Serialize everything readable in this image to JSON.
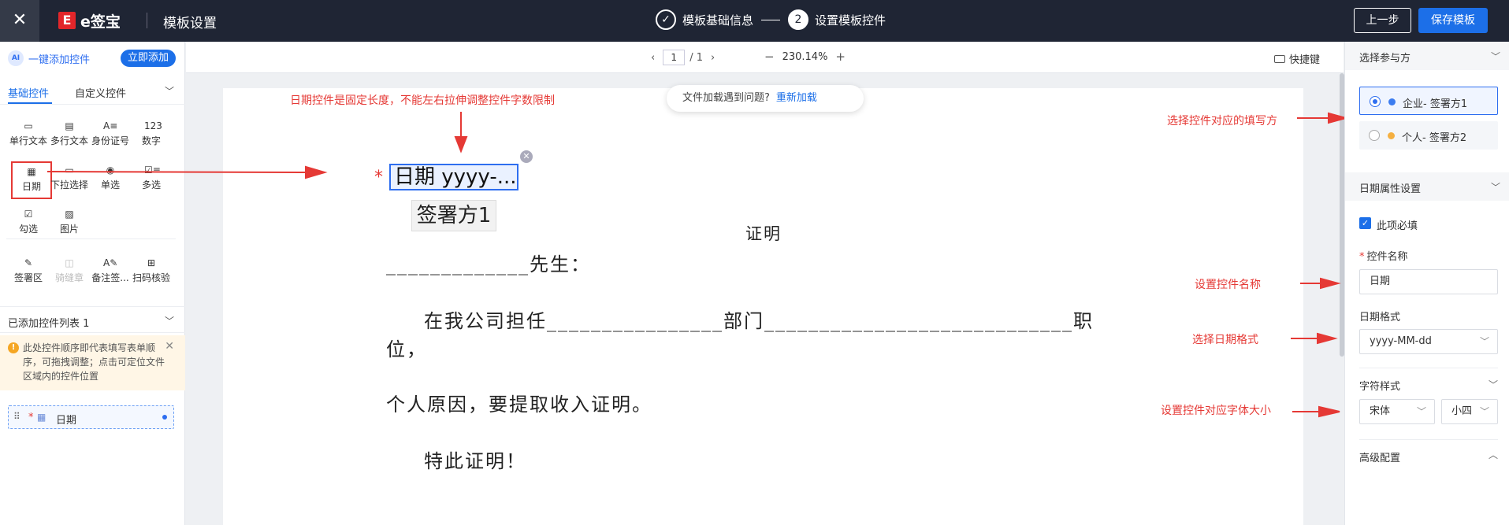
{
  "topbar": {
    "close_icon": "close-icon",
    "logo_mark": "E",
    "logo_text": "e签宝",
    "page_name": "模板设置",
    "steps": [
      {
        "num": "✓",
        "label": "模板基础信息"
      },
      {
        "num": "2",
        "label": "设置模板控件"
      }
    ],
    "prev_label": "上一步",
    "save_label": "保存模板"
  },
  "left": {
    "ai_icon_text": "AI",
    "ai_label": "一键添加控件",
    "ai_button": "立即添加",
    "tabs": [
      "基础控件",
      "自定义控件"
    ],
    "controls": [
      {
        "label": "单行文本",
        "icon": "▭"
      },
      {
        "label": "多行文本",
        "icon": "▤"
      },
      {
        "label": "身份证号",
        "icon": "A≡"
      },
      {
        "label": "数字",
        "icon": "123"
      },
      {
        "label": "日期",
        "icon": "▦"
      },
      {
        "label": "下拉选择",
        "icon": "▭"
      },
      {
        "label": "单选",
        "icon": "◉"
      },
      {
        "label": "多选",
        "icon": "☑≡"
      },
      {
        "label": "勾选",
        "icon": "☑"
      },
      {
        "label": "图片",
        "icon": "▨"
      },
      {
        "label": "签署区",
        "icon": "✎"
      },
      {
        "label": "骑缝章",
        "icon": "◫"
      },
      {
        "label": "备注签...",
        "icon": "A✎"
      },
      {
        "label": "扫码核验",
        "icon": "⊞"
      }
    ],
    "added_title": "已添加控件列表 1",
    "tip_icon_text": "!",
    "tip_text": "此处控件顺序即代表填写表单顺序，可拖拽调整；点击可定位文件区域内的控件位置",
    "added_items": [
      {
        "label": "日期"
      }
    ]
  },
  "toolbar": {
    "page_current": "1",
    "page_total": "/ 1",
    "zoom": "230.14%",
    "hotkey": "快捷键"
  },
  "notice": {
    "text": "文件加载遇到问题?",
    "link": "重新加载"
  },
  "annotations": {
    "top": "日期控件是固定长度，不能左右拉伸调整控件字数限制",
    "signer": "选择控件对应的填写方",
    "name": "设置控件名称",
    "format": "选择日期格式",
    "font": "设置控件对应字体大小"
  },
  "document": {
    "date_field": "日期 yyyy-...",
    "signer_tag": "签署方1",
    "title": "证明",
    "line1": "_____________先生：",
    "line2": "在我公司担任________________部门____________________________职",
    "line3": "位，",
    "line4": "个人原因，要提取收入证明。",
    "line5": "特此证明！"
  },
  "right": {
    "signer_section": "选择参与方",
    "parties": [
      {
        "label": "企业- 签署方1",
        "color": "#3b7cf0",
        "selected": true
      },
      {
        "label": "个人- 签署方2",
        "color": "#f5b041",
        "selected": false
      }
    ],
    "date_section": "日期属性设置",
    "required_label": "此项必填",
    "name_label": "控件名称",
    "name_value": "日期",
    "format_label": "日期格式",
    "format_value": "yyyy-MM-dd",
    "font_label": "字符样式",
    "font_family": "宋体",
    "font_size": "小四",
    "advanced_label": "高级配置"
  }
}
